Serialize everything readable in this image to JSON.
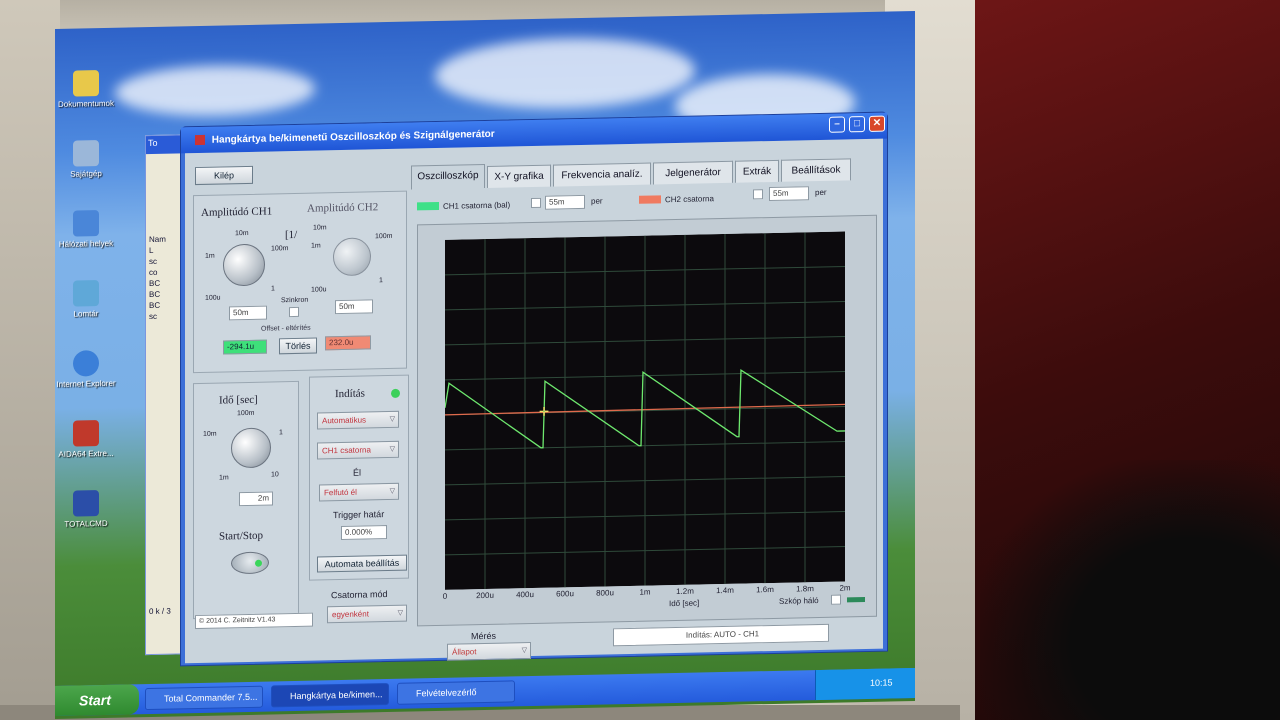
{
  "desktop": {
    "icons": [
      {
        "label": "Dokumentumok",
        "color": "#e8c84a"
      },
      {
        "label": "Sajátgép",
        "color": "#9bb7d9"
      },
      {
        "label": "Hálózati helyek",
        "color": "#4a86d8"
      },
      {
        "label": "Lomtár",
        "color": "#5fa8d8"
      },
      {
        "label": "Internet Explorer",
        "color": "#3b7fd8"
      },
      {
        "label": "AIDA64 Extre...",
        "color": "#c0392b"
      },
      {
        "label": "TOTALCMD",
        "color": "#2b4ea8"
      }
    ]
  },
  "back_window": {
    "title": "To",
    "rows": [
      "Nam",
      "L",
      "sc",
      "co",
      "BC",
      "BC",
      "BC",
      "sc"
    ],
    "status": "0 k / 3"
  },
  "app": {
    "title": "Hangkártya be/kimenetű Oszcilloszkóp és Szignálgenerátor",
    "exit_button": "Kilép",
    "amplitude_ch1_label": "Amplitúdó CH1",
    "amplitude_ch2_label": "Amplitúdó CH2",
    "bracket_label": "[1/",
    "amp_ticks": {
      "t100u": "100u",
      "t1m": "1m",
      "t10m": "10m",
      "t100m": "100m",
      "t1": "1"
    },
    "ch1_amp_value": "50m",
    "ch2_amp_value": "50m",
    "sync_label": "Szinkron",
    "offset_label": "Offset - eltérítés",
    "ch1_offset_value": "-294.1u",
    "clear_button": "Törlés",
    "ch2_offset_value": "232.0u",
    "time_label": "Idő [sec]",
    "time_ticks": {
      "t1m": "1m",
      "t10m": "10m",
      "t100m": "100m",
      "t1": "1",
      "t10": "10"
    },
    "time_value": "2m",
    "start_stop_label": "Start/Stop",
    "trigger_title": "Indítás",
    "trigger_mode": "Automatikus",
    "trigger_channel": "CH1 csatorna",
    "edge_label": "Él",
    "edge_value": "Felfutó él",
    "trigger_level_label": "Trigger határ",
    "trigger_level_value": "0.000%",
    "auto_settings_button": "Automata beállítás",
    "channel_mode_label": "Csatorna mód",
    "channel_mode_value": "egyenként",
    "copyright": "© 2014  C. Zeitnitz V1.43",
    "tabs": [
      "Oszcilloszkóp",
      "X-Y grafika",
      "Frekvencia analíz.",
      "Jelgenerátor",
      "Extrák",
      "Beállítások"
    ],
    "ch1_legend": "CH1 csatorna (bal)",
    "ch1_per_value": "55m",
    "ch2_legend": "CH2 csatorna",
    "ch2_per_value": "55m",
    "per_label": "per",
    "x_axis_label": "Idő [sec]",
    "x_ticks": [
      "0",
      "200u",
      "400u",
      "600u",
      "800u",
      "1m",
      "1.2m",
      "1.4m",
      "1.6m",
      "1.8m",
      "2m"
    ],
    "scope_grid_label": "Szkóp háló",
    "measure_label": "Mérés",
    "measure_value": "Állapot",
    "status_text": "Indítás: AUTO - CH1",
    "colors": {
      "ch1": "#6ee86e",
      "ch2": "#e06a4c",
      "trace_bg": "#0c0a0d",
      "grid": "#2f4a3a"
    }
  },
  "chart_data": {
    "type": "line",
    "xlabel": "Idő [sec]",
    "x_ticks": [
      "0",
      "200u",
      "400u",
      "600u",
      "800u",
      "1m",
      "1.2m",
      "1.4m",
      "1.6m",
      "1.8m",
      "2m"
    ],
    "xlim": [
      0,
      0.002
    ],
    "ylim": [
      -5,
      5
    ],
    "grid": true,
    "series": [
      {
        "name": "CH1 csatorna (bal)",
        "color": "#6ee86e",
        "x": [
          0.0,
          2e-05,
          0.00048,
          0.00049,
          0.0005,
          0.00097,
          0.00098,
          0.00099,
          0.00146,
          0.00147,
          0.00148,
          0.00196,
          0.00197,
          0.002
        ],
        "y": [
          0.2,
          0.9,
          -1.0,
          -1.0,
          0.9,
          -1.0,
          -1.0,
          1.1,
          -0.8,
          -0.8,
          1.1,
          -0.7,
          -0.7,
          -0.7
        ]
      },
      {
        "name": "CH2 csatorna",
        "color": "#e06a4c",
        "x": [
          0.0,
          0.002
        ],
        "y": [
          0.0,
          0.06
        ]
      }
    ]
  },
  "taskbar": {
    "start": "Start",
    "items": [
      "Total Commander 7.5...",
      "Hangkártya be/kimen...",
      "Felvételvezérlő"
    ],
    "clock": "10:15"
  }
}
